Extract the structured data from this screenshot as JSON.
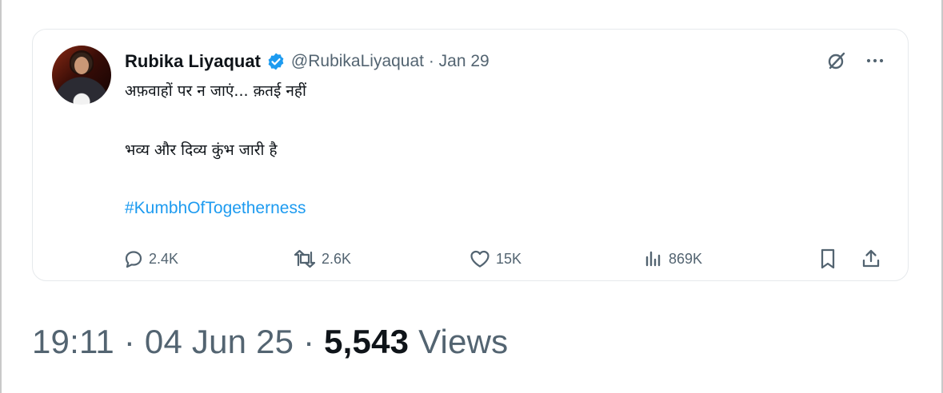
{
  "tweet": {
    "author_name": "Rubika Liyaquat",
    "handle_and_date": "@RubikaLiyaquat · Jan 29",
    "text_line1": "अफ़वाहों पर न जाएं... क़तई नहीं",
    "text_line2": "भव्य और दिव्य कुंभ जारी है",
    "hashtag": "#KumbhOfTogetherness",
    "replies": "2.4K",
    "retweets": "2.6K",
    "likes": "15K",
    "views": "869K"
  },
  "post_meta": {
    "time_date": "19:11 · 04 Jun 25 · ",
    "view_count": "5,543",
    "views_label": " Views"
  },
  "colors": {
    "accent": "#1d9bf0",
    "muted": "#536471",
    "text": "#0f1419"
  },
  "icons": [
    "verified-badge-icon",
    "grok-icon",
    "more-icon",
    "reply-icon",
    "retweet-icon",
    "like-icon",
    "views-icon",
    "bookmark-icon",
    "share-icon"
  ]
}
